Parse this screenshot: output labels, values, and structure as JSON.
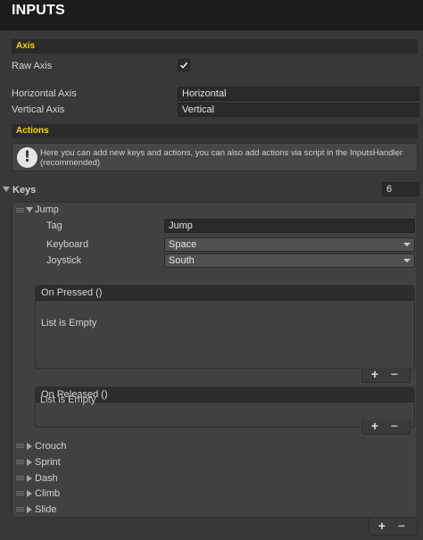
{
  "header": {
    "title": "INPUTS"
  },
  "axis": {
    "section_title": "Axis",
    "raw_axis": {
      "label": "Raw Axis",
      "checked": true
    },
    "horizontal": {
      "label": "Horizontal Axis",
      "value": "Horizontal"
    },
    "vertical": {
      "label": "Vertical Axis",
      "value": "Vertical"
    }
  },
  "actions": {
    "section_title": "Actions",
    "help_text": "Here you can add new keys and actions, you can also add actions via script in the InputsHandler (recommended)"
  },
  "keys": {
    "label": "Keys",
    "count": "6",
    "expanded_item": {
      "name": "Jump",
      "tag_label": "Tag",
      "tag_value": "Jump",
      "keyboard_label": "Keyboard",
      "keyboard_value": "Space",
      "joystick_label": "Joystick",
      "joystick_value": "South",
      "on_pressed": {
        "title": "On Pressed ()",
        "empty_text": "List is Empty"
      },
      "on_released": {
        "title": "On Released ()",
        "empty_text": "List is Empty"
      }
    },
    "collapsed_items": [
      "Crouch",
      "Sprint",
      "Dash",
      "Climb",
      "Slide"
    ],
    "add_symbol": "+",
    "remove_symbol": "−"
  },
  "colors": {
    "section_accent": "#ffd800",
    "background": "#383838",
    "title_bar": "#1c1c1c"
  }
}
